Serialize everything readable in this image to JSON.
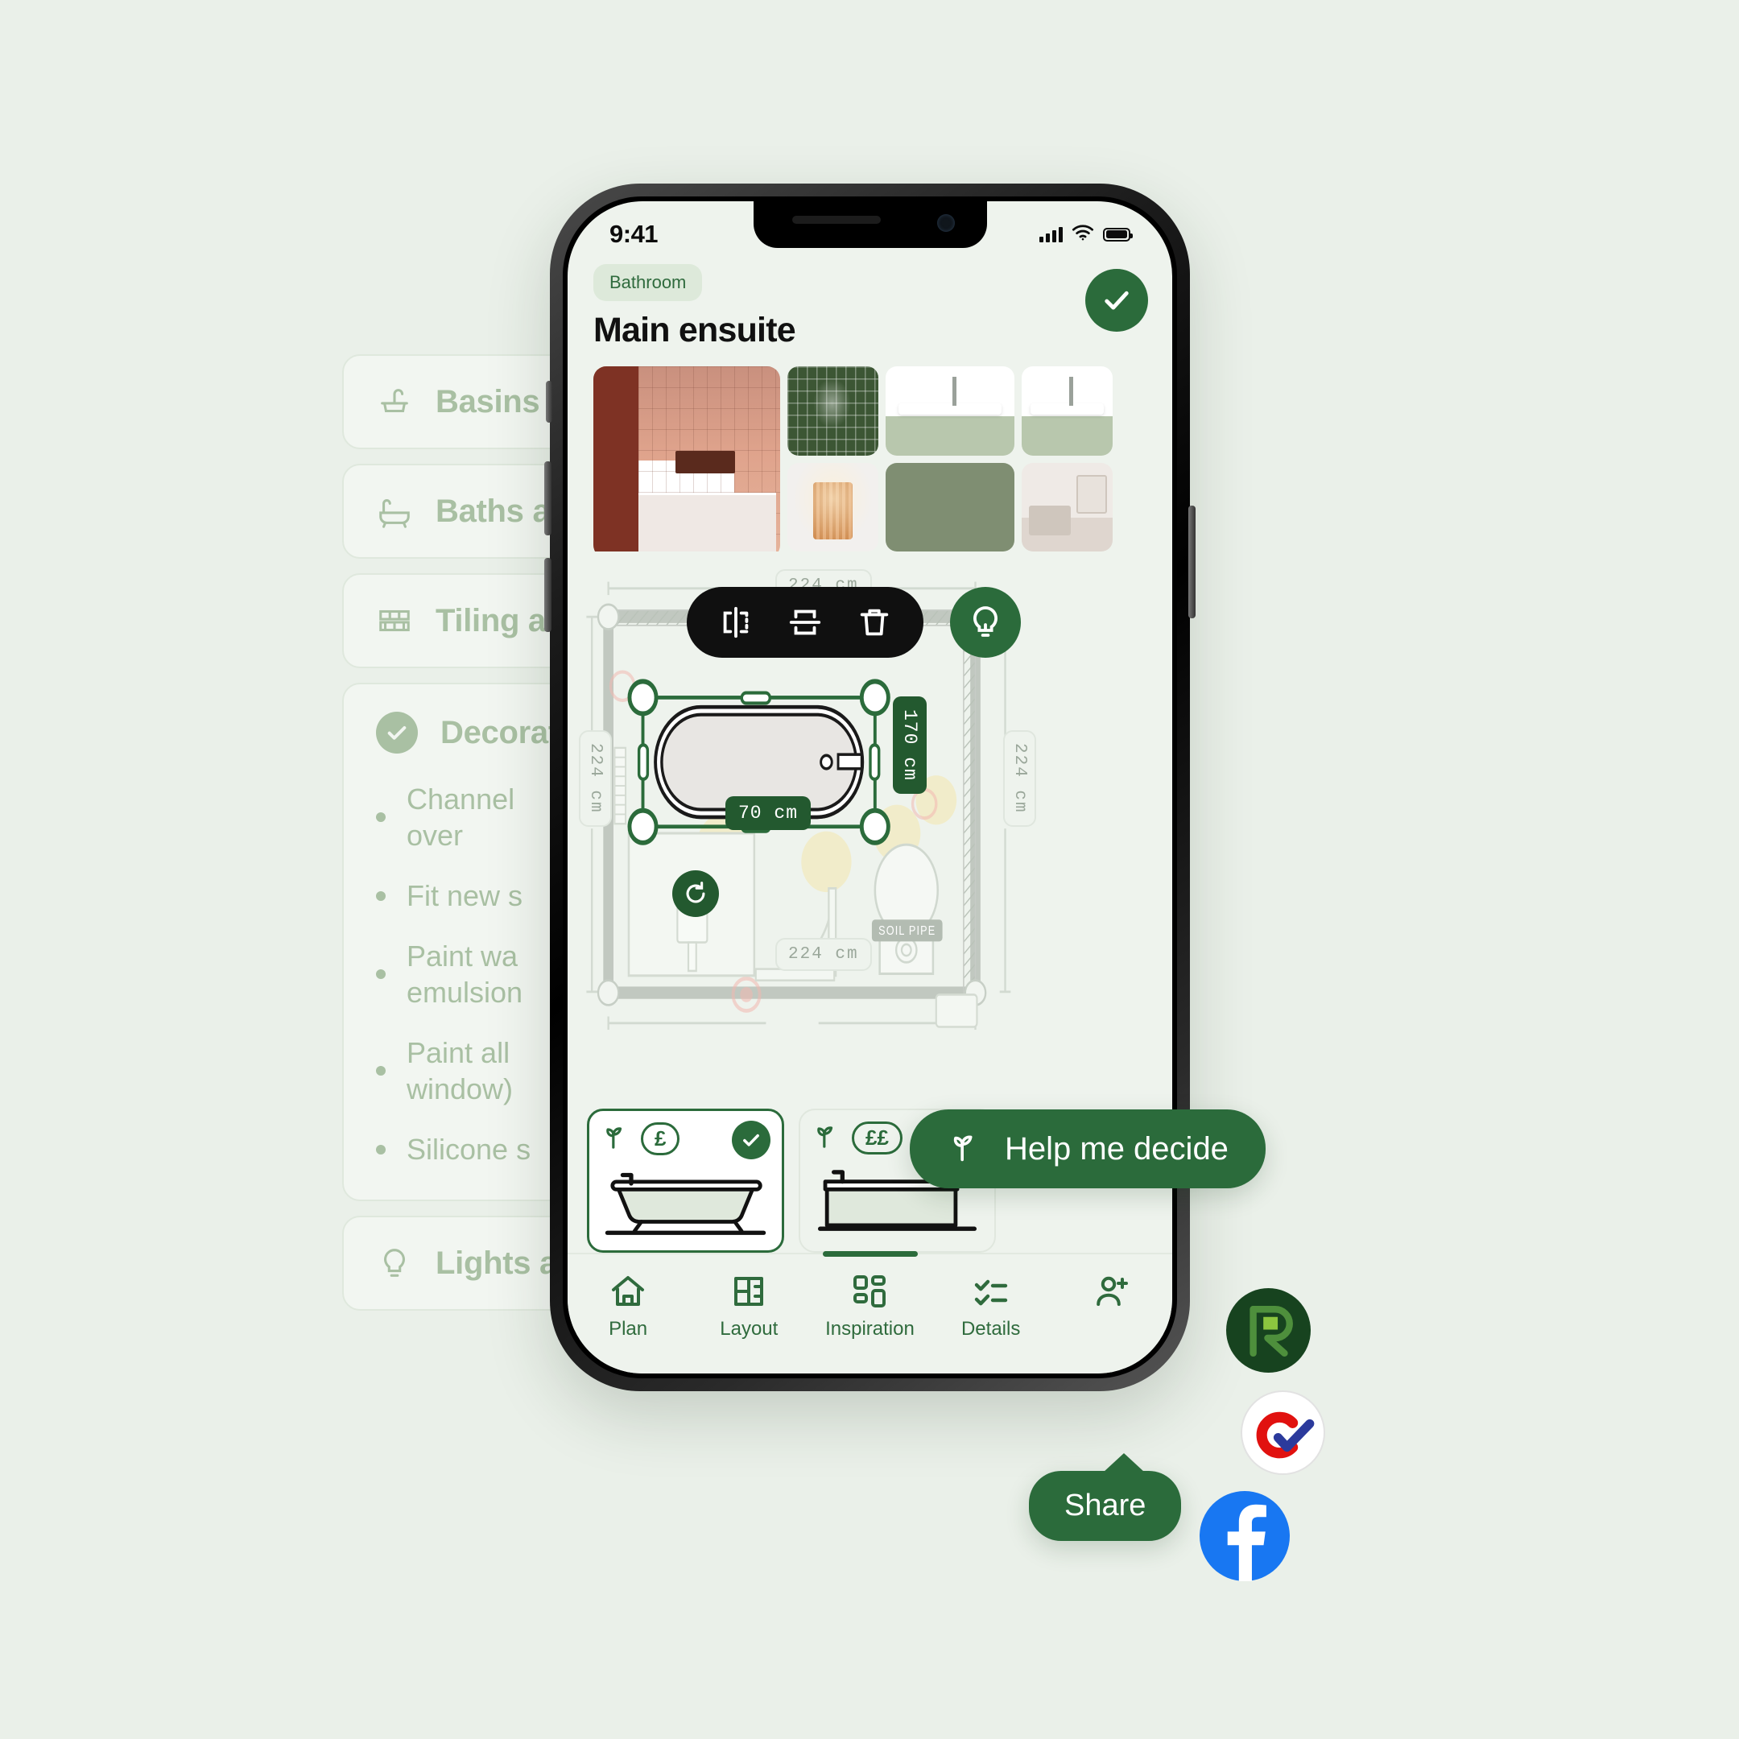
{
  "background_list": {
    "items": [
      {
        "icon": "basin-icon",
        "label": "Basins",
        "expanded": false
      },
      {
        "icon": "bath-icon",
        "label": "Baths an",
        "expanded": false
      },
      {
        "icon": "tile-icon",
        "label": "Tiling an",
        "expanded": false
      },
      {
        "icon": "check-circle-icon",
        "label": "Decorati",
        "expanded": true,
        "sub_items": [
          "Channel\nover",
          "Fit new s",
          "Paint wa\nemulsion",
          "Paint all\nwindow)",
          "Silicone s"
        ]
      },
      {
        "icon": "bulb-icon",
        "label": "Lights an",
        "expanded": false
      }
    ]
  },
  "status_bar": {
    "time": "9:41",
    "signal_icon": "cellular-bars-icon",
    "wifi_icon": "wifi-icon",
    "battery_icon": "battery-full-icon"
  },
  "header": {
    "chip": "Bathroom",
    "title": "Main ensuite",
    "done_icon": "check-icon"
  },
  "gallery": {
    "images": [
      {
        "name": "terracotta-bathroom-photo"
      },
      {
        "name": "green-tile-photo"
      },
      {
        "name": "basin-vanity-photo"
      },
      {
        "name": "wall-light-photo"
      },
      {
        "name": "sage-swatch"
      },
      {
        "name": "room-corner-photo"
      }
    ]
  },
  "floorplan": {
    "dim_top": "224 cm",
    "dim_left": "224 cm",
    "dim_right": "224 cm",
    "dim_bottom": "224 cm",
    "selected_item": {
      "name": "bathtub",
      "length": "170 cm",
      "width": "70 cm"
    },
    "soil_pipe_label": "SOIL PIPE",
    "toolbar": {
      "mirror_horizontal": "mirror-horizontal-icon",
      "mirror_vertical": "mirror-vertical-icon",
      "delete": "trash-icon"
    },
    "bulb_button": "lightbulb-icon",
    "rotate_button": "rotate-icon"
  },
  "product_cards": [
    {
      "eco_icon": "leaf-icon",
      "price": "£",
      "selected": true,
      "art": "freestanding-bath-icon"
    },
    {
      "eco_icon": "leaf-icon",
      "price": "££",
      "selected": false,
      "art": "straight-bath-icon"
    }
  ],
  "tabbar": {
    "items": [
      {
        "icon": "home-icon",
        "label": "Plan"
      },
      {
        "icon": "layout-icon",
        "label": "Layout"
      },
      {
        "icon": "grid-icon",
        "label": "Inspiration"
      },
      {
        "icon": "checklist-icon",
        "label": "Details"
      },
      {
        "icon": "person-add-icon",
        "label": ""
      }
    ]
  },
  "overlays": {
    "help_pill": {
      "icon": "leaf-icon",
      "label": "Help me decide"
    },
    "share_pill": {
      "label": "Share"
    },
    "badges": [
      {
        "name": "resi-logo-badge",
        "color": "#17431f"
      },
      {
        "name": "checkatrade-logo-badge",
        "color": "#ffffff"
      },
      {
        "name": "facebook-logo-badge",
        "color": "#1877f2"
      }
    ]
  }
}
